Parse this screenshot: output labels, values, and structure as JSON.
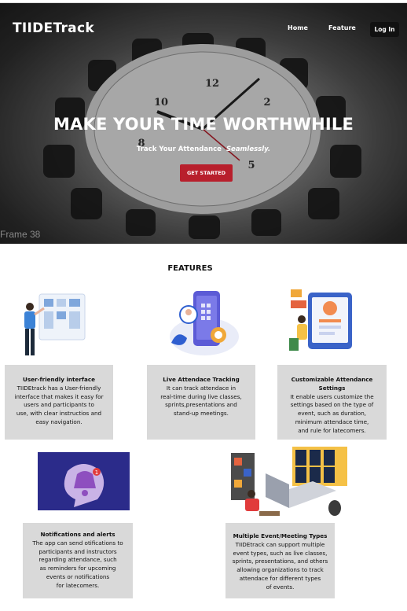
{
  "header": {
    "brand": "TIIDETrack",
    "nav": {
      "home": "Home",
      "feature": "Feature",
      "login": "Log In"
    }
  },
  "hero": {
    "title": "MAKE YOUR TIME WORTHWHILE",
    "subtitle": "Track Your Attendance",
    "subtitle_emphasis": "Seamlessly.",
    "cta": "GET STARTED",
    "frame_label": "Frame 38"
  },
  "features": {
    "heading": "FEATURES",
    "items": [
      {
        "title": "User-friendly interface",
        "text": "TIIDEtrack has a User-friendly\ninterface that makes it easy for\nusers and participants to\nuse, with clear instructios and\neasy navigation."
      },
      {
        "title": "Live Attendace Tracking",
        "text": "It can track attendace in\nreal-time during live classes,\nsprints,presentations and\nstand-up meetings."
      },
      {
        "title": "Customizable Attendance Settings",
        "text": "It enable users customize the\nsettings based on the type of\nevent, such as duration,\nminimum attendace time,\nand rule for latecomers."
      },
      {
        "title": "Notifications and alerts",
        "text": "The app can send otifications to\nparticipants and instructors\nregarding attendance, such\nas reminders for upcoming\nevents or notifications\nfor latecomers."
      },
      {
        "title": "Multiple Event/Meeting Types",
        "text": "TIIDEtrack can support multiple\nevent types, such as live classes,\nsprints, presentations, and others\nallowing organizations to track\nattendace for different types\nof events."
      }
    ]
  },
  "colors": {
    "accent": "#b81f2c",
    "card_bg": "#d9d9d9",
    "login_bg": "#111111"
  },
  "icons": [
    "clock-illustration",
    "user-interface-illustration",
    "phone-tracking-illustration",
    "settings-illustration",
    "notification-bell-icon",
    "meeting-illustration"
  ]
}
